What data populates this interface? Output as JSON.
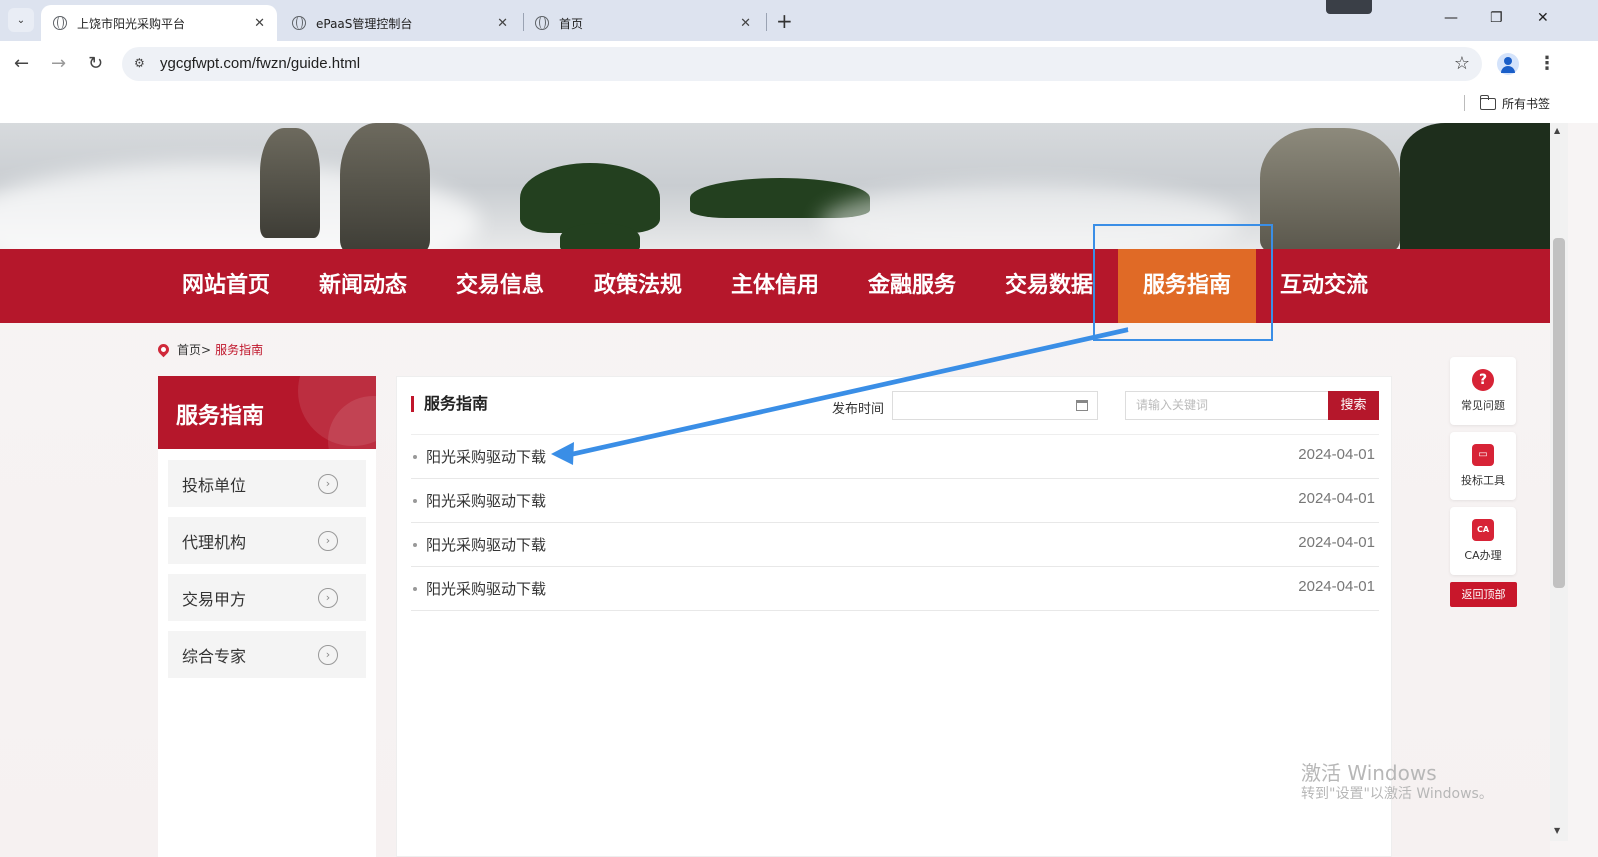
{
  "browser": {
    "tabs": [
      {
        "title": "上饶市阳光采购平台",
        "close": "✕"
      },
      {
        "title": "ePaaS管理控制台",
        "close": "✕"
      },
      {
        "title": "首页",
        "close": "✕"
      }
    ],
    "tab_menu": "⌄",
    "new_tab": "+",
    "window": {
      "minimize": "—",
      "maximize": "❐",
      "close": "✕"
    },
    "back": "←",
    "forward": "→",
    "reload": "↻",
    "site_info": "⚙",
    "url": "ygcgfwpt.com/fwzn/guide.html",
    "star": "☆",
    "kebab": "⋮",
    "bookmarks_all": "所有书签"
  },
  "nav": {
    "items": [
      "网站首页",
      "新闻动态",
      "交易信息",
      "政策法规",
      "主体信用",
      "金融服务",
      "交易数据",
      "服务指南",
      "互动交流"
    ],
    "active_index": 7
  },
  "breadcrumb": {
    "home": "首页>",
    "current": "服务指南"
  },
  "sidebar": {
    "title": "服务指南",
    "items": [
      {
        "label": "投标单位",
        "chevron": "›"
      },
      {
        "label": "代理机构",
        "chevron": "›"
      },
      {
        "label": "交易甲方",
        "chevron": "›"
      },
      {
        "label": "综合专家",
        "chevron": "›"
      }
    ]
  },
  "main": {
    "title": "服务指南",
    "date_label": "发布时间",
    "date_value": "",
    "search_placeholder": "请输入关键词",
    "search_button": "搜索",
    "rows": [
      {
        "title": "阳光采购驱动下载",
        "date": "2024-04-01"
      },
      {
        "title": "阳光采购驱动下载",
        "date": "2024-04-01"
      },
      {
        "title": "阳光采购驱动下载",
        "date": "2024-04-01"
      },
      {
        "title": "阳光采购驱动下载",
        "date": "2024-04-01"
      }
    ]
  },
  "float_tools": [
    {
      "label": "常见问题",
      "icon": "?"
    },
    {
      "label": "投标工具",
      "icon": "▭"
    },
    {
      "label": "CA办理",
      "icon": "CA"
    }
  ],
  "back_to_top": "返回顶部",
  "watermark": {
    "line1": "激活 Windows",
    "line2": "转到\"设置\"以激活 Windows。"
  },
  "colors": {
    "brand_red": "#b5172b",
    "active_orange": "#e06a26",
    "annotation_blue": "#3a8ee6"
  }
}
